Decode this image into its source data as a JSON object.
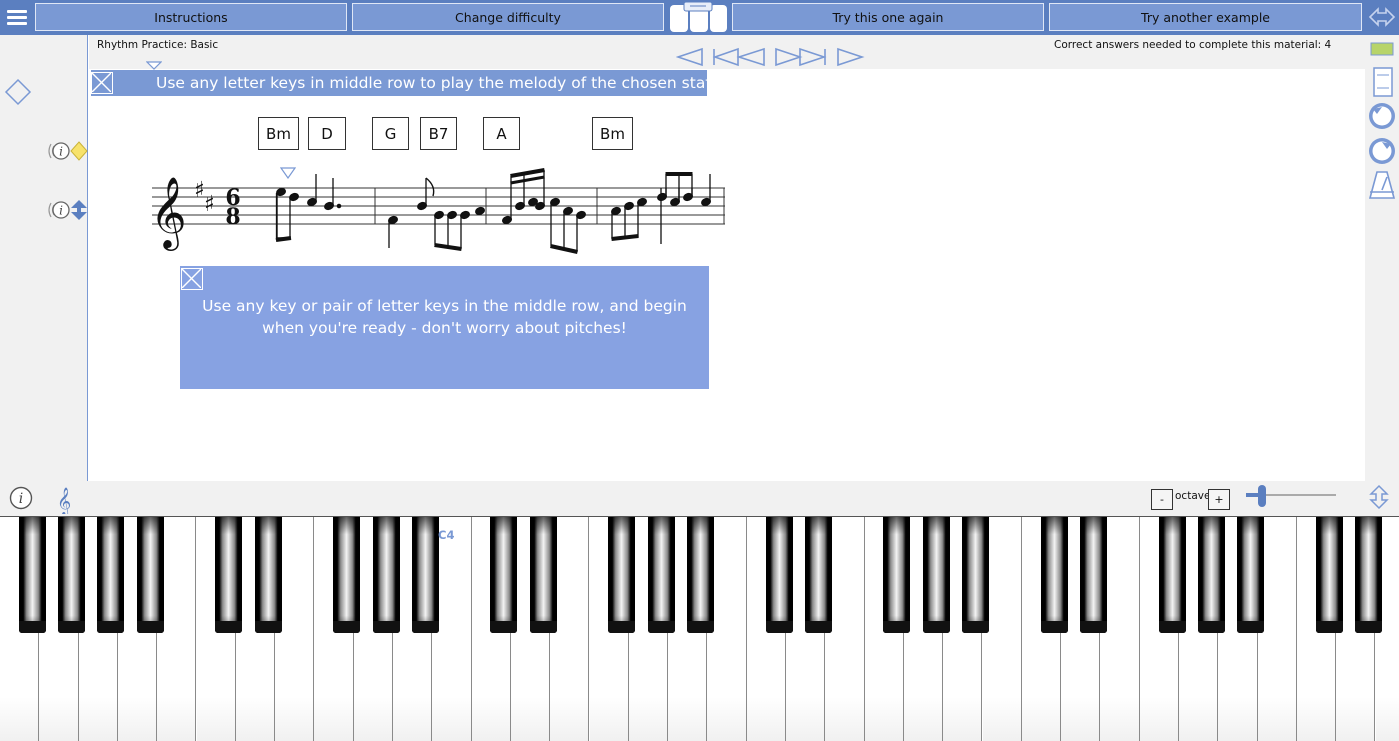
{
  "toolbar": {
    "instructions_label": "Instructions",
    "difficulty_label": "Change difficulty",
    "try_again_label": "Try this one again",
    "try_another_label": "Try another example"
  },
  "header": {
    "title": "Rhythm Practice: Basic",
    "progress_text": "Correct answers needed to complete this material: 4"
  },
  "banner": {
    "text": "Use any letter keys in middle row to play the melody of the chosen staff"
  },
  "chords": [
    "Bm",
    "D",
    "G",
    "B7",
    "A",
    "Bm"
  ],
  "score": {
    "time_signature_top": "6",
    "time_signature_bottom": "8",
    "key": "2 sharps",
    "clef": "treble"
  },
  "hint": {
    "text": "Use any key or pair of letter keys in the middle row, and begin when you're ready - don't worry about pitches!"
  },
  "octave": {
    "label": "octave",
    "minus": "-",
    "plus": "+",
    "slider_level": 0.18
  },
  "keyboard": {
    "middle_c_label": "C4"
  },
  "colors": {
    "accent": "#5b7fc0",
    "button": "#7a99d4",
    "hint_bg": "#87a2e2",
    "gutter": "#f1f1f1"
  },
  "icons": [
    "menu-icon",
    "piano-icon",
    "double-arrow-icon",
    "diamond-icon",
    "info-icon",
    "treble-clef-icon",
    "undo-icon",
    "redo-icon",
    "metronome-icon"
  ]
}
